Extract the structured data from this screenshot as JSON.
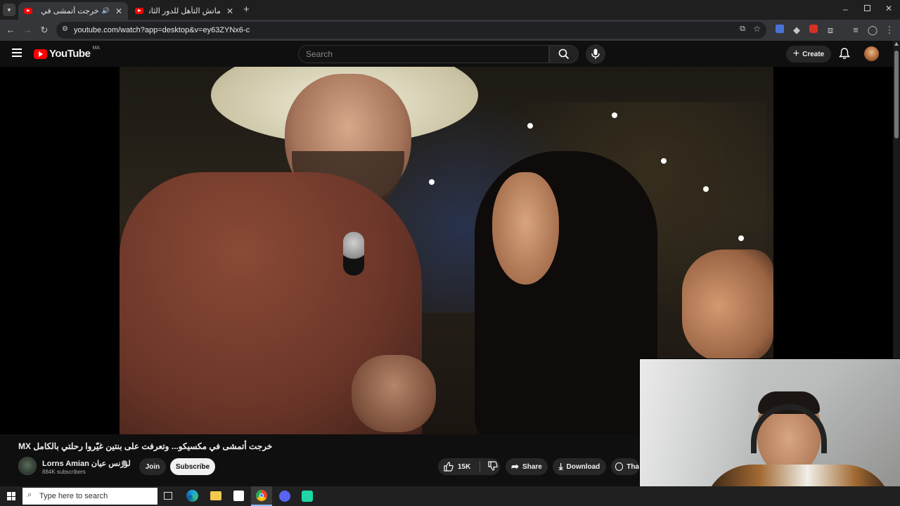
{
  "browser": {
    "tabs": [
      {
        "title": "خرجت أتمشى في مكسيكو... و",
        "active": true,
        "audio": true
      },
      {
        "title": "ماتش التأهل للدور الثاني؟ التشكـ",
        "active": false,
        "audio": false
      }
    ],
    "new_tab_label": "+",
    "url": "youtube.com/watch?app=desktop&v=ey63ZYNx6-c"
  },
  "youtube": {
    "logo_text": "YouTube",
    "region": "MA",
    "search_placeholder": "Search",
    "create_label": "Create",
    "video_title": "خرجت أتمشى في مكسيكو... وتعرفت على بنتين غيّروا رحلتي بالكامل MX",
    "channel_name": "Lorns Amian لورنس عيان",
    "subscribers": "884K subscribers",
    "join_label": "Join",
    "subscribe_label": "Subscribe",
    "likes": "15K",
    "share_label": "Share",
    "download_label": "Download",
    "thanks_label": "Tha"
  },
  "taskbar": {
    "search_placeholder": "Type here to search"
  },
  "colors": {
    "yt_red": "#ff0000",
    "bg": "#0f0f0f",
    "pill": "#272727"
  }
}
